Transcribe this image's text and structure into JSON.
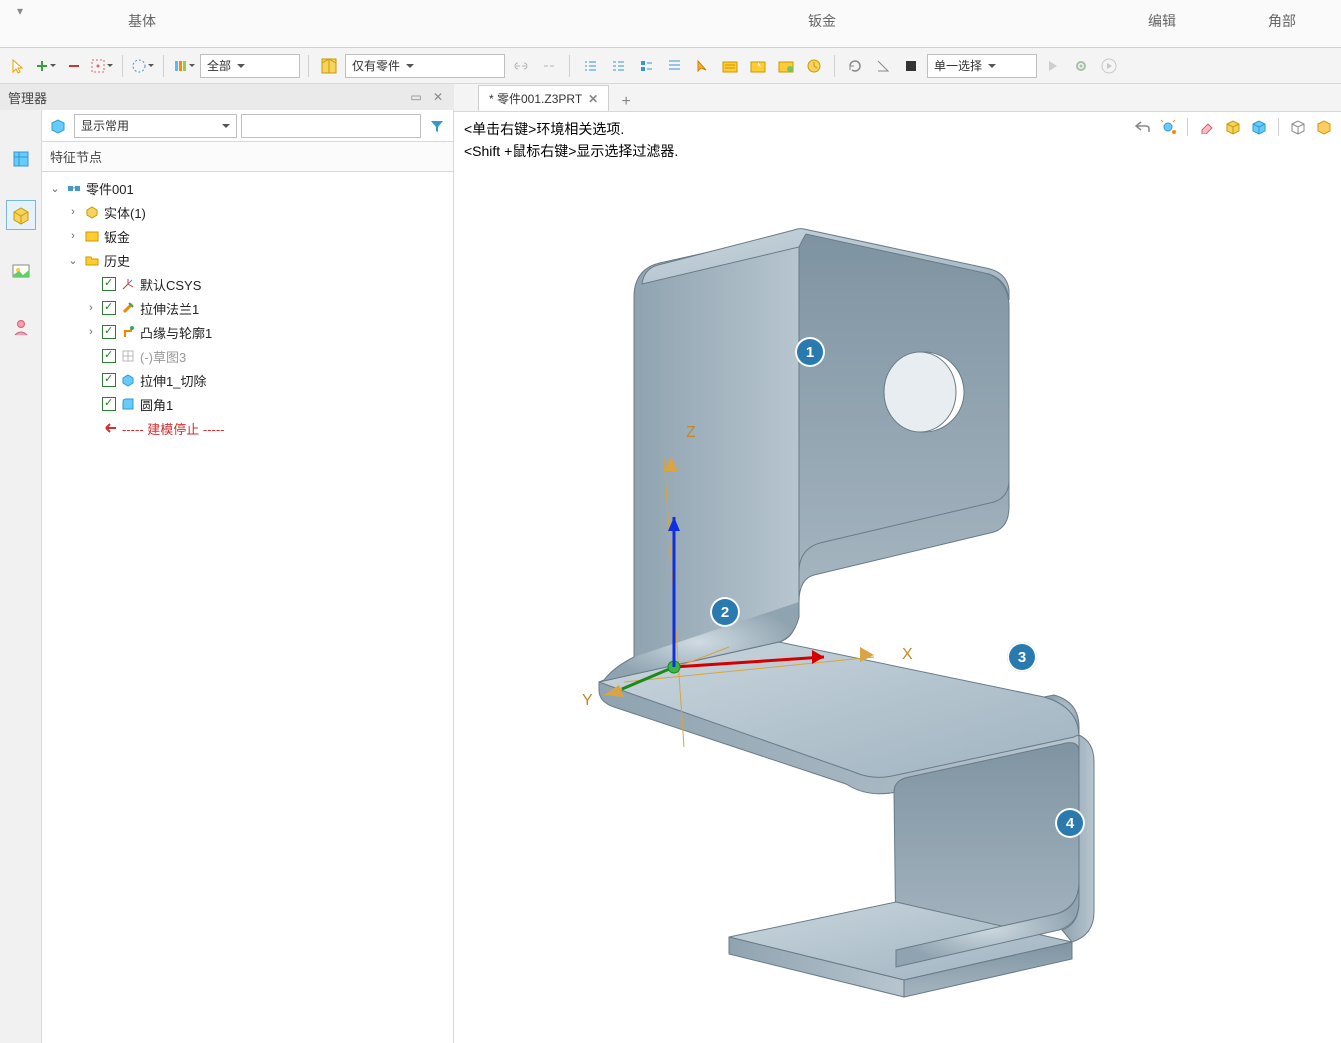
{
  "ribbon": {
    "tabs": [
      "基体",
      "钣金",
      "编辑",
      "角部"
    ],
    "handle": "▾"
  },
  "toolbar": {
    "filter_all": "全部",
    "filter_parts": "仅有零件",
    "select_mode": "单一选择"
  },
  "manager": {
    "title": "管理器"
  },
  "panel": {
    "display_common": "显示常用",
    "tree_header": "特征节点"
  },
  "tree": {
    "root": "零件001",
    "solid": "实体(1)",
    "sheetmetal": "钣金",
    "history": "历史",
    "csys": "默认CSYS",
    "flange": "拉伸法兰1",
    "contour": "凸缘与轮廓1",
    "sketch": "(-)草图3",
    "extrude_cut": "拉伸1_切除",
    "fillet": "圆角1",
    "stop": "----- 建模停止 -----"
  },
  "doc": {
    "tab_name": "* 零件001.Z3PRT"
  },
  "hints": {
    "l1": "<单击右键>环境相关选项.",
    "l2": "<Shift +鼠标右键>显示选择过滤器."
  },
  "axes": {
    "x": "X",
    "y": "Y",
    "z": "Z"
  },
  "callouts": [
    "1",
    "2",
    "3",
    "4"
  ]
}
